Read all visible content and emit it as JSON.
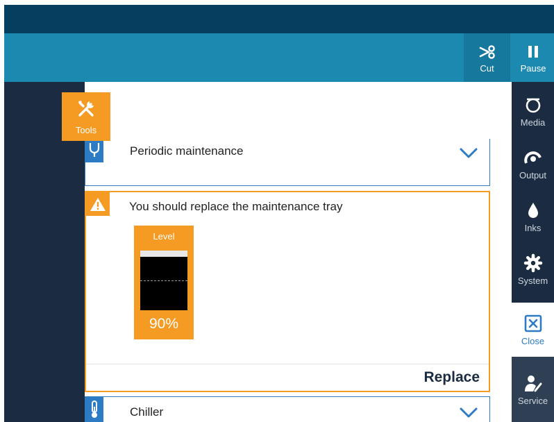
{
  "header": {
    "cut_label": "Cut",
    "pause_label": "Pause"
  },
  "tools_tab": {
    "label": "Tools"
  },
  "sections": {
    "periodic": {
      "title": "Periodic maintenance"
    },
    "warning": {
      "title": "You should replace the maintenance tray",
      "gauge_label": "Level",
      "level_percent": 90,
      "level_text": "90%",
      "action_label": "Replace"
    },
    "chiller": {
      "title": "Chiller"
    }
  },
  "nav": {
    "media": "Media",
    "output": "Output",
    "inks": "Inks",
    "system": "System",
    "close": "Close",
    "service": "Service"
  },
  "icons": {
    "cut": "scissors-icon",
    "pause": "pause-icon",
    "tools": "wrench-screwdriver-icon",
    "periodic": "stethoscope-icon",
    "warning": "warning-triangle-icon",
    "chiller": "thermometer-icon",
    "media": "media-roll-icon",
    "output": "output-icon",
    "inks": "ink-drop-icon",
    "system": "gear-icon",
    "close": "close-box-icon",
    "service": "service-person-icon"
  },
  "colors": {
    "header_dark": "#053e5e",
    "header": "#1c8ab0",
    "panel_dark": "#1b2c42",
    "accent_orange": "#f59a23",
    "accent_blue": "#2c7bc4"
  }
}
